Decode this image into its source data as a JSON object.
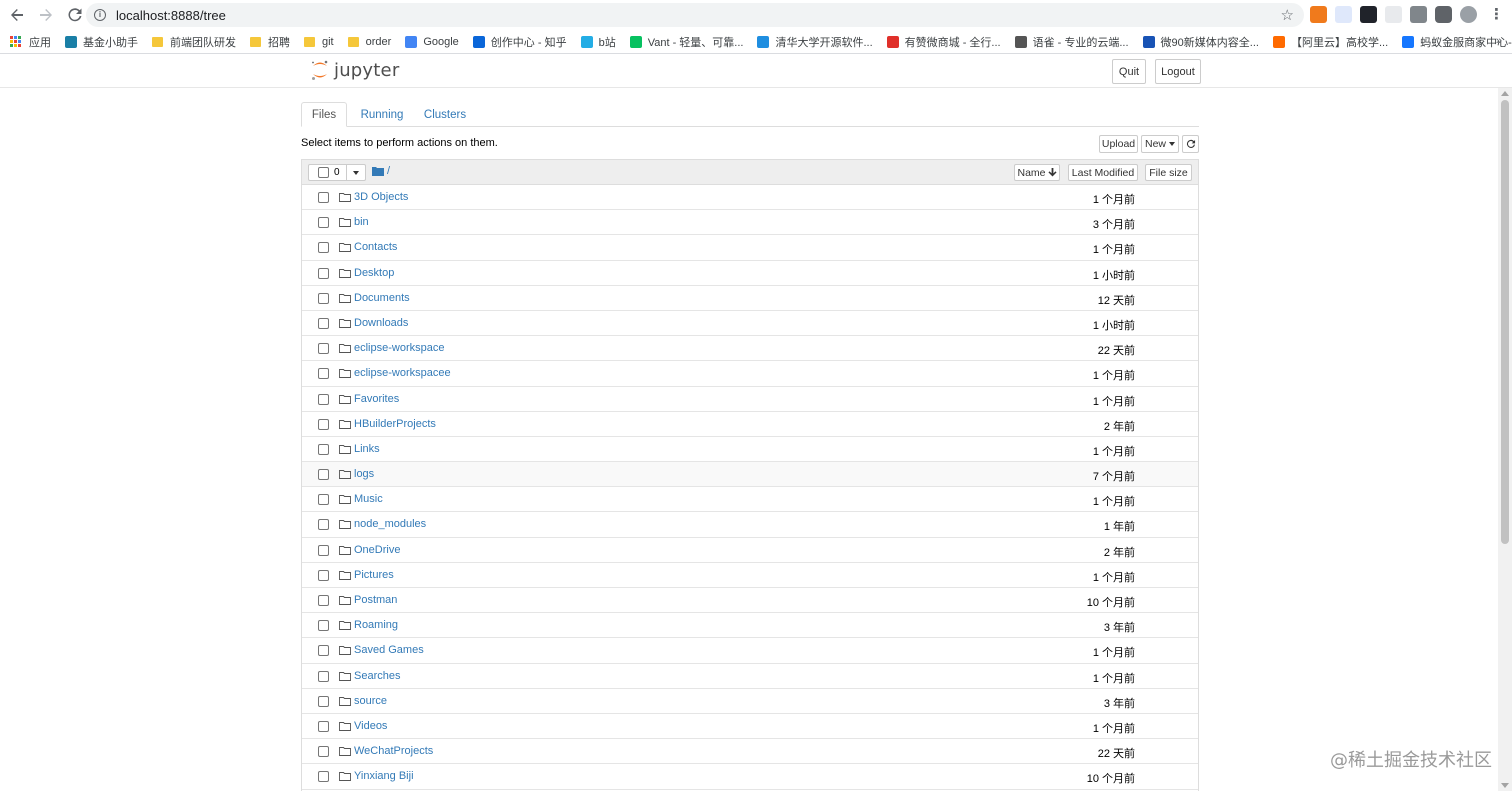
{
  "browser": {
    "url": "localhost:8888/tree",
    "bookmarks": [
      {
        "label": "应用",
        "icon": "apps-grid-icon"
      },
      {
        "label": "基金小助手",
        "icon": "react-icon",
        "color": "#1a7fa6"
      },
      {
        "label": "前端团队研发",
        "icon": "folder-icon"
      },
      {
        "label": "招聘",
        "icon": "folder-icon"
      },
      {
        "label": "git",
        "icon": "folder-icon"
      },
      {
        "label": "order",
        "icon": "folder-icon"
      },
      {
        "label": "Google",
        "icon": "google-icon",
        "color": "#4285f4"
      },
      {
        "label": "创作中心 - 知乎",
        "icon": "zhihu-icon",
        "color": "#0a66d9"
      },
      {
        "label": "b站",
        "icon": "bilibili-icon",
        "color": "#23ade5"
      },
      {
        "label": "Vant - 轻量、可靠...",
        "icon": "vant-icon",
        "color": "#07c160"
      },
      {
        "label": "清华大学开源软件...",
        "icon": "tsinghua-icon",
        "color": "#1f8ee0"
      },
      {
        "label": "有赞微商城 - 全行...",
        "icon": "youzan-icon",
        "color": "#e0302a"
      },
      {
        "label": "语雀 - 专业的云端...",
        "icon": "yuque-icon",
        "color": "#555555"
      },
      {
        "label": "微90新媒体内容全...",
        "icon": "wei90-icon",
        "color": "#1853b5"
      },
      {
        "label": "【阿里云】高校学...",
        "icon": "aliyun-icon",
        "color": "#ff6a00"
      },
      {
        "label": "蚂蚁金服商家中心-...",
        "icon": "ant-icon",
        "color": "#1677ff"
      }
    ],
    "bookmarks_more": "»"
  },
  "jupyter": {
    "logo_text": "jupyter",
    "quit_label": "Quit",
    "logout_label": "Logout",
    "tabs": [
      {
        "label": "Files",
        "active": true
      },
      {
        "label": "Running",
        "active": false
      },
      {
        "label": "Clusters",
        "active": false
      }
    ],
    "hint": "Select items to perform actions on them.",
    "upload_label": "Upload",
    "new_label": "New",
    "selected_count": "0",
    "breadcrumb": "/",
    "sort_name_label": "Name",
    "sort_modified_label": "Last Modified",
    "sort_size_label": "File size",
    "files": [
      {
        "name": "3D Objects",
        "modified": "1 个月前"
      },
      {
        "name": "bin",
        "modified": "3 个月前"
      },
      {
        "name": "Contacts",
        "modified": "1 个月前"
      },
      {
        "name": "Desktop",
        "modified": "1 小时前"
      },
      {
        "name": "Documents",
        "modified": "12 天前"
      },
      {
        "name": "Downloads",
        "modified": "1 小时前"
      },
      {
        "name": "eclipse-workspace",
        "modified": "22 天前"
      },
      {
        "name": "eclipse-workspacee",
        "modified": "1 个月前"
      },
      {
        "name": "Favorites",
        "modified": "1 个月前"
      },
      {
        "name": "HBuilderProjects",
        "modified": "2 年前"
      },
      {
        "name": "Links",
        "modified": "1 个月前"
      },
      {
        "name": "logs",
        "modified": "7 个月前"
      },
      {
        "name": "Music",
        "modified": "1 个月前"
      },
      {
        "name": "node_modules",
        "modified": "1 年前"
      },
      {
        "name": "OneDrive",
        "modified": "2 年前"
      },
      {
        "name": "Pictures",
        "modified": "1 个月前"
      },
      {
        "name": "Postman",
        "modified": "10 个月前"
      },
      {
        "name": "Roaming",
        "modified": "3 年前"
      },
      {
        "name": "Saved Games",
        "modified": "1 个月前"
      },
      {
        "name": "Searches",
        "modified": "1 个月前"
      },
      {
        "name": "source",
        "modified": "3 年前"
      },
      {
        "name": "Videos",
        "modified": "1 个月前"
      },
      {
        "name": "WeChatProjects",
        "modified": "22 天前"
      },
      {
        "name": "Yinxiang Biji",
        "modified": "10 个月前"
      }
    ]
  },
  "watermark": "@稀土掘金技术社区",
  "colors": {
    "link": "#337ab7",
    "jupyter_orange": "#f37726",
    "header_bg": "#eeeeee"
  }
}
